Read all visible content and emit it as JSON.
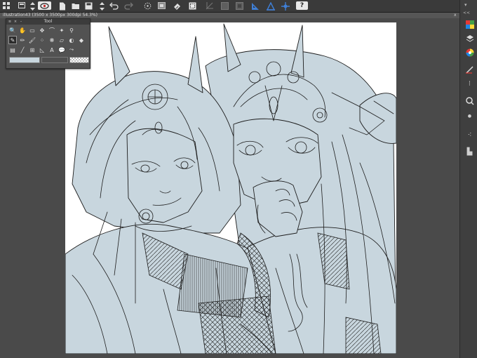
{
  "toolbar": {
    "help_label": "?",
    "icons": [
      "grid-menu-icon",
      "new-canvas-icon",
      "up-down-arrows-icon",
      "view-eye-icon",
      "new-file-icon",
      "open-file-icon",
      "save-file-icon",
      "up-down-arrows-icon",
      "undo-icon",
      "redo-icon",
      "transform-icon",
      "stamp-icon",
      "eraser-icon",
      "selection-icon",
      "crop-icon",
      "fill-layer-icon",
      "grid-icon",
      "ruler-icon",
      "color-pick-icon",
      "help-icon"
    ]
  },
  "document_tab": {
    "title": "illustration43 (3500 x 3500px 300dpi 54.3%)",
    "close_label": "x"
  },
  "tool_palette": {
    "title": "Tool"
  },
  "side_panel": {
    "collapse_label": "<<",
    "icons": [
      "color-palette-icon",
      "layers-icon",
      "color-wheel-icon",
      "brush-settings-icon",
      "airbrush-icon",
      "search-icon",
      "spray-icon",
      "dot-brush-icon",
      "material-icon"
    ]
  },
  "colors": {
    "canvas_bg": "#ffffff",
    "line_art": "#1d1d1d",
    "fill": "#c8d6de",
    "app_bg": "#4a4a4a",
    "toolbar_bg": "#3a3a3a"
  }
}
